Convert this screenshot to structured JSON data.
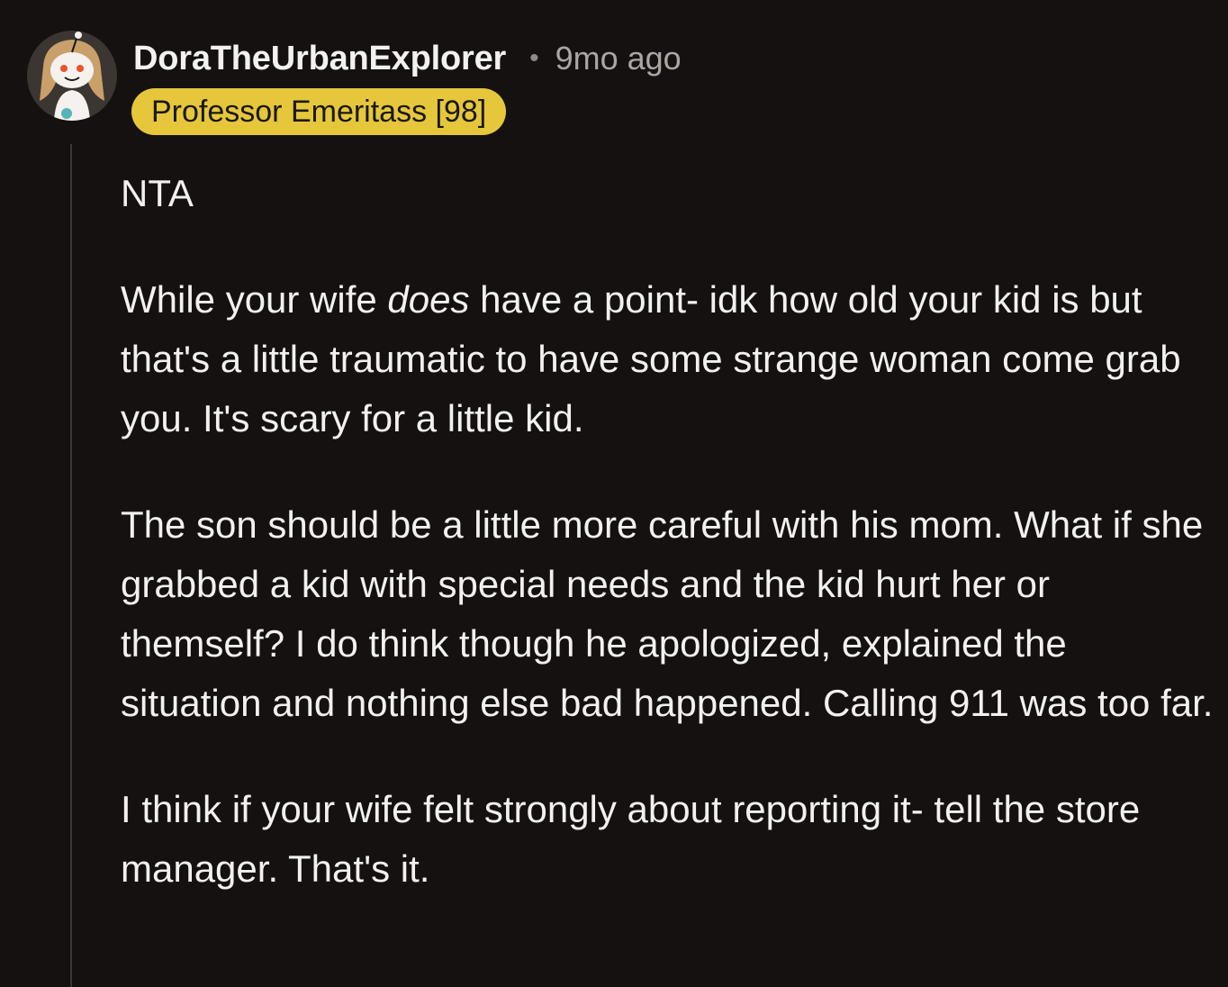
{
  "comment": {
    "username": "DoraTheUrbanExplorer",
    "separator": "•",
    "timestamp": "9mo ago",
    "flair": "Professor Emeritass [98]",
    "avatar_icon": "snoo-avatar-icon",
    "paragraphs": {
      "p1": "NTA",
      "p2_before": "While your wife ",
      "p2_emphasis": "does",
      "p2_after": " have a point- idk how old your kid is but that's a little traumatic to have some strange woman come grab you. It's scary for a little kid.",
      "p3": "The son should be a little more careful with his mom. What if she grabbed a kid with special needs and the kid hurt her or themself? I do think though he apologized, explained the situation and nothing else bad happened. Calling 911 was too far.",
      "p4": "I think if your wife felt strongly about reporting it- tell the store manager. That's it."
    }
  },
  "colors": {
    "background": "#141110",
    "text": "#f2f1ef",
    "meta": "#a9a6a3",
    "flair_bg": "#e6c73b",
    "flair_text": "#1a1814",
    "thread_line": "#3a3735"
  }
}
